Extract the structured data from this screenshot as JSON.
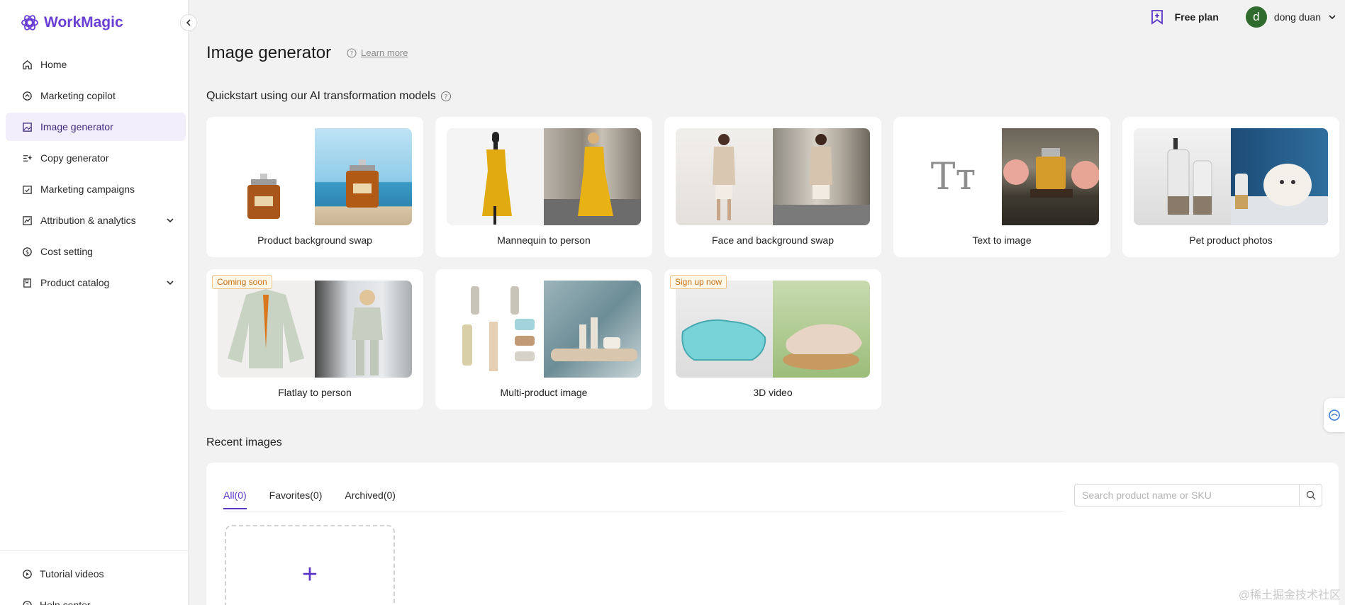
{
  "app": {
    "name": "WorkMagic"
  },
  "sidebar": {
    "items": [
      {
        "label": "Home",
        "icon": "home-icon"
      },
      {
        "label": "Marketing copilot",
        "icon": "copilot-icon"
      },
      {
        "label": "Image generator",
        "icon": "image-icon",
        "active": true
      },
      {
        "label": "Copy generator",
        "icon": "sparkle-text-icon"
      },
      {
        "label": "Marketing campaigns",
        "icon": "calendar-check-icon"
      },
      {
        "label": "Attribution & analytics",
        "icon": "chart-icon",
        "expandable": true
      },
      {
        "label": "Cost setting",
        "icon": "dollar-icon"
      },
      {
        "label": "Product catalog",
        "icon": "book-icon",
        "expandable": true
      }
    ],
    "bottom": [
      {
        "label": "Tutorial videos",
        "icon": "play-icon"
      },
      {
        "label": "Help center",
        "icon": "help-icon"
      }
    ]
  },
  "topbar": {
    "plan_label": "Free plan",
    "avatar_letter": "d",
    "user_name": "dong duan"
  },
  "main": {
    "title": "Image generator",
    "learn_more": "Learn more",
    "quickstart_title": "Quickstart using our AI transformation models",
    "models": [
      {
        "label": "Product background swap"
      },
      {
        "label": "Mannequin to person"
      },
      {
        "label": "Face and background swap"
      },
      {
        "label": "Text to image",
        "placeholder_glyph": "Tт"
      },
      {
        "label": "Pet product photos"
      },
      {
        "label": "Flatlay to person",
        "badge": "Coming soon"
      },
      {
        "label": "Multi-product image"
      },
      {
        "label": "3D video",
        "badge": "Sign up now"
      }
    ],
    "recent_title": "Recent images",
    "tabs": [
      {
        "label": "All(0)",
        "active": true
      },
      {
        "label": "Favorites(0)"
      },
      {
        "label": "Archived(0)"
      }
    ],
    "search_placeholder": "Search product name or SKU",
    "upload_glyph": "+"
  },
  "watermark": "@稀土掘金技术社区",
  "colors": {
    "accent": "#5b38c7",
    "brand": "#6a3fd4",
    "active_bg": "#f3eefc",
    "badge": "#c46f14"
  }
}
